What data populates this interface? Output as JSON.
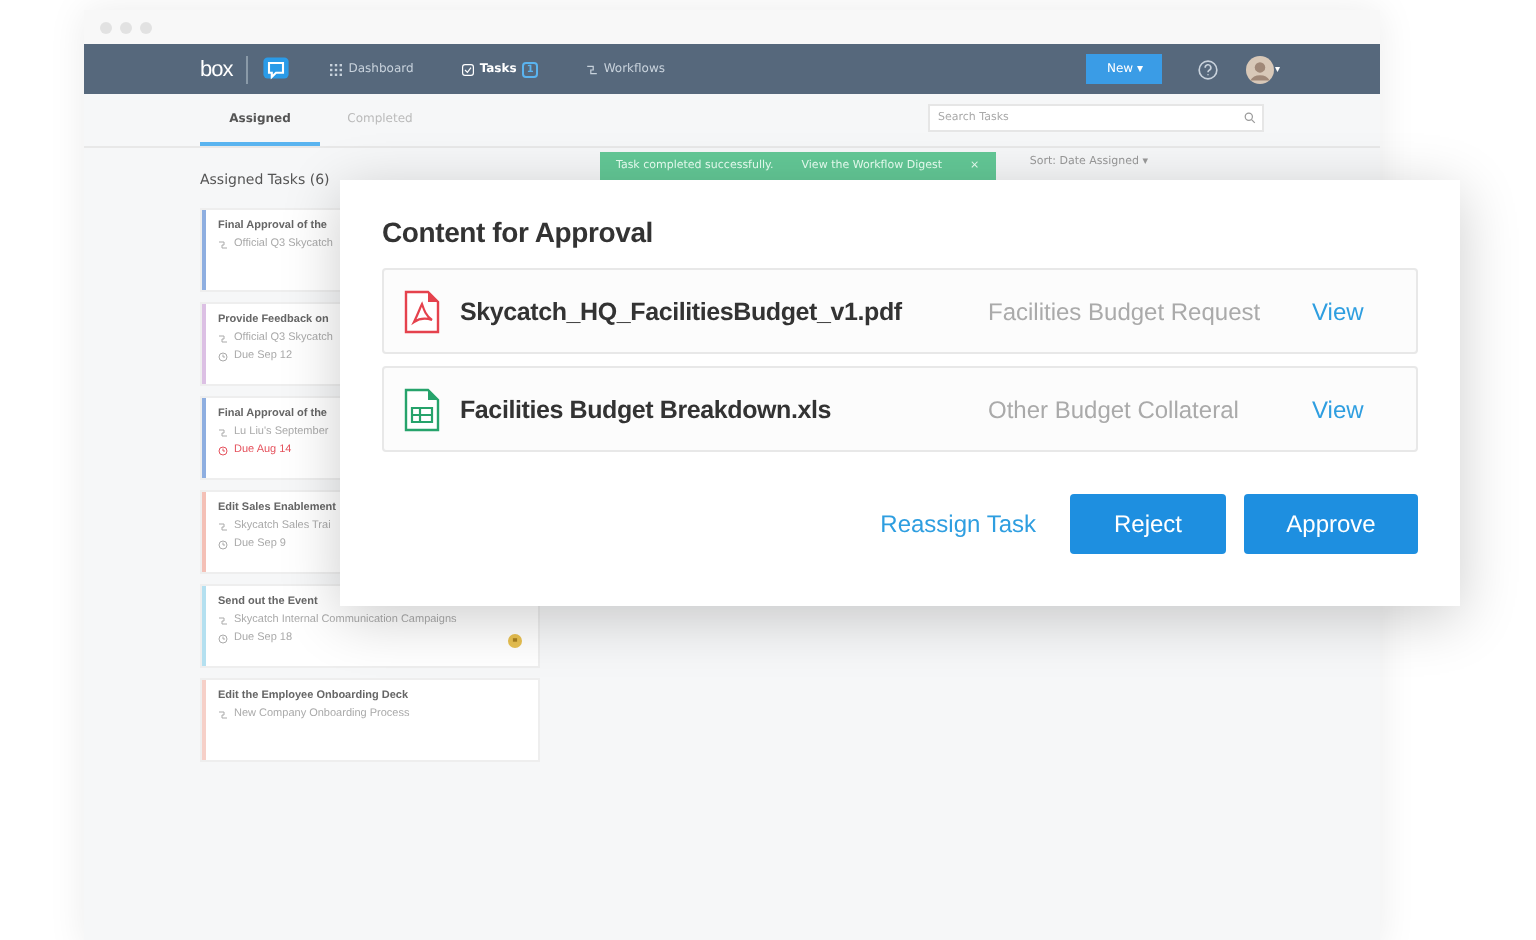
{
  "nav": {
    "logo": "box",
    "items": [
      {
        "label": "Dashboard",
        "kind": "grid",
        "selected": false
      },
      {
        "label": "Tasks",
        "kind": "check",
        "selected": true,
        "badge": "1"
      },
      {
        "label": "Workflows",
        "kind": "flow",
        "selected": false
      }
    ],
    "new_button": "New ▾",
    "avatar_caret": "▾"
  },
  "tabs": [
    {
      "label": "Assigned",
      "selected": true
    },
    {
      "label": "Completed",
      "selected": false
    }
  ],
  "search": {
    "placeholder": "Search Tasks"
  },
  "list_title": "Assigned Tasks (6)",
  "toast": {
    "message": "Task completed successfully.",
    "link": "View the Workflow Digest",
    "close": "×"
  },
  "sort": "Sort: Date Assigned ▾",
  "tasks": [
    {
      "title": "Final Approval of the",
      "workflow": "Official Q3 Skycatch",
      "color": "#8eaee0"
    },
    {
      "title": "Provide Feedback on",
      "workflow": "Official Q3 Skycatch",
      "due": "Due Sep 12",
      "color": "#dcc0e4",
      "overdue": false
    },
    {
      "title": "Final Approval of the",
      "workflow": "Lu Liu's September",
      "due": "Due Aug 14",
      "color": "#8eaee0",
      "overdue": true
    },
    {
      "title": "Edit Sales Enablement",
      "workflow": "Skycatch Sales Trai",
      "due": "Due Sep 9",
      "color": "#f4c0b6",
      "overdue": false
    },
    {
      "title": "Send out the Event",
      "workflow": "Skycatch Internal Communication Campaigns",
      "due": "Due Sep 18",
      "color": "#b4e0f0",
      "overdue": false,
      "flagged": true
    },
    {
      "title": "Edit the Employee Onboarding Deck",
      "workflow": "New Company Onboarding Process",
      "color": "#f6d0c8"
    }
  ],
  "modal": {
    "title": "Content for Approval",
    "files": [
      {
        "name": "Skycatch_HQ_FacilitiesBudget_v1.pdf",
        "kind": "pdf",
        "description": "Facilities Budget Request",
        "action": "View"
      },
      {
        "name": "Facilities Budget Breakdown.xls",
        "kind": "sheet",
        "description": "Other Budget Collateral",
        "action": "View"
      }
    ],
    "reassign": "Reassign Task",
    "reject": "Reject",
    "approve": "Approve"
  }
}
